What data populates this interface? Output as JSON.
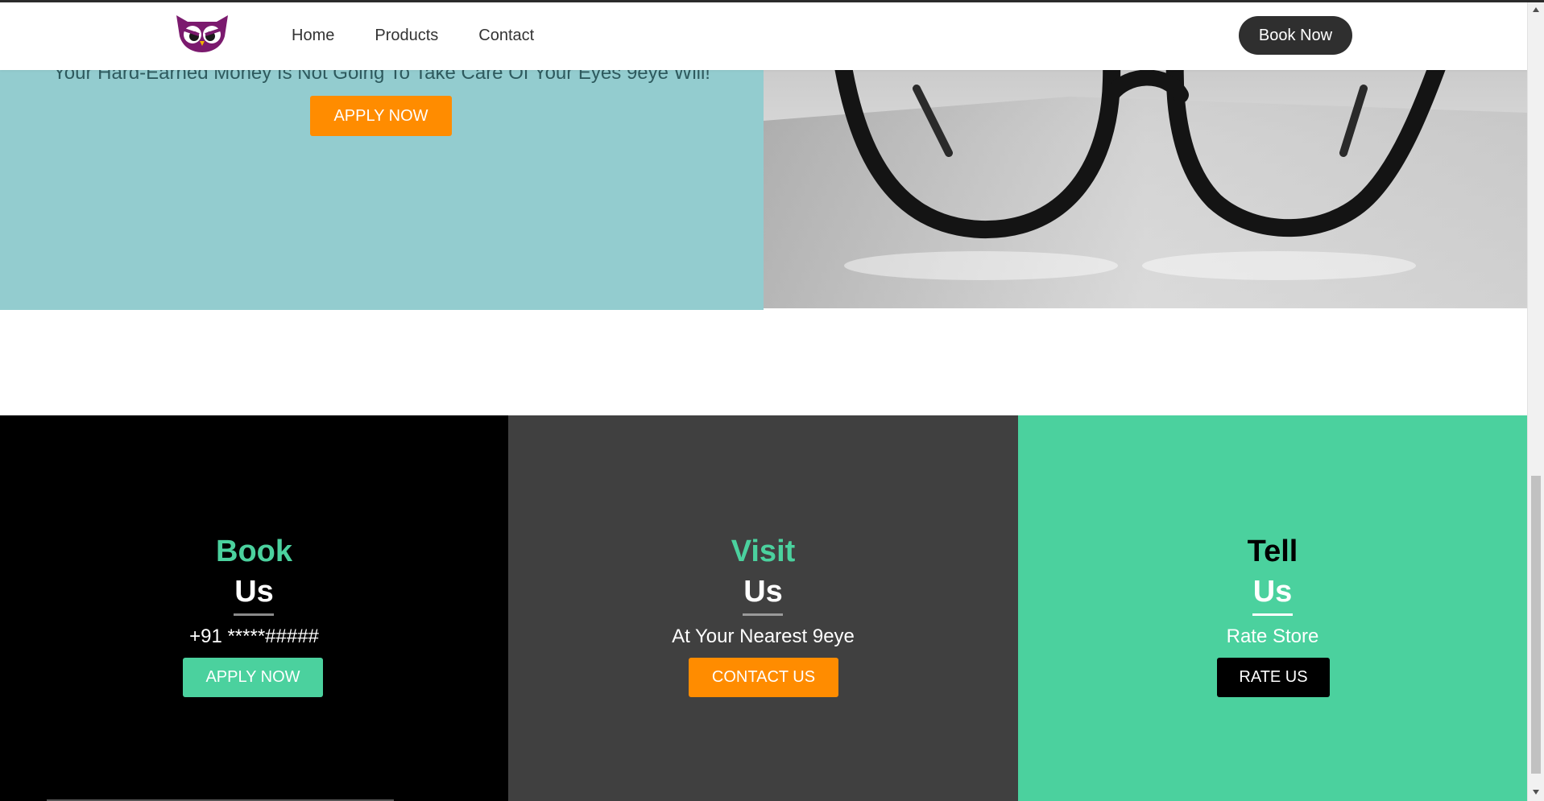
{
  "brand": {
    "logo_icon": "owl-logo-icon",
    "logo_color": "#7b1a6e"
  },
  "nav": {
    "links": [
      "Home",
      "Products",
      "Contact"
    ],
    "book_now_label": "Book Now"
  },
  "hero": {
    "text": "Your Hard-Earned Money Is Not Going To Take Care Of Your Eyes 9eye Will!",
    "button_label": "APPLY NOW",
    "image_icon": "eyeglasses-photo",
    "left_bg": "#93cccf",
    "button_color": "#ff8c00"
  },
  "sections": [
    {
      "title": "Book",
      "subtitle": "Us",
      "text": "+91 *****#####",
      "button_label": "APPLY NOW",
      "bg": "#000000",
      "title_color": "#4bd19e",
      "button_color": "#4bd19e"
    },
    {
      "title": "Visit",
      "subtitle": "Us",
      "text": "At Your Nearest 9eye",
      "button_label": "CONTACT US",
      "bg": "#404040",
      "title_color": "#4bd19e",
      "button_color": "#ff8c00"
    },
    {
      "title": "Tell",
      "subtitle": "Us",
      "text": "Rate Store",
      "button_label": "RATE US",
      "bg": "#4bd19e",
      "title_color": "#000000",
      "button_color": "#000000"
    }
  ]
}
